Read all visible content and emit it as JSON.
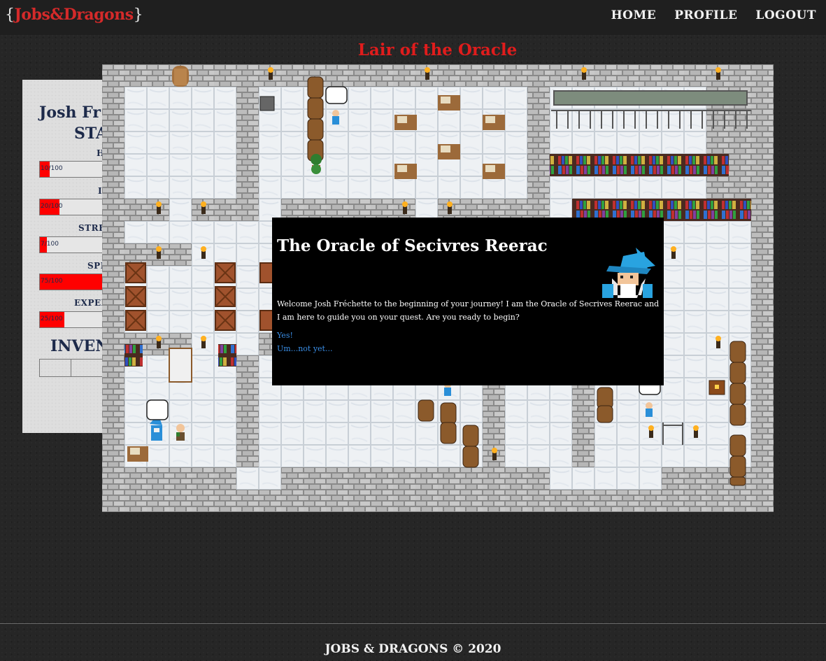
{
  "nav": {
    "brand_open": "{",
    "brand_name": "Jobs&Dragons",
    "brand_close": "}",
    "links": [
      "HOME",
      "PROFILE",
      "LOGOUT"
    ]
  },
  "page_title": "Lair of the Oracle",
  "stats": {
    "player_name": "Josh Fr",
    "heading": "STA",
    "items": [
      {
        "label": "H",
        "text": "10/100",
        "fraction": 0.1
      },
      {
        "label": "I",
        "text": "20/100",
        "fraction": 0.2
      },
      {
        "label": "STRE",
        "text": "7/100",
        "fraction": 0.07
      },
      {
        "label": "SPE",
        "text": "75/100",
        "fraction": 0.75
      },
      {
        "label": "EXPER",
        "text": "25/100",
        "fraction": 0.25
      }
    ],
    "inventory_heading": "INVEN"
  },
  "dialog": {
    "title": "The Oracle of Secivres Reerac",
    "message": "Welcome Josh Fréchette to the beginning of your journey! I am the Oracle of Secrives Reerac and I am here to guide you on your quest. Are you ready to begin?",
    "option_yes": "Yes!",
    "option_no": "Um...not yet..."
  },
  "footer": "JOBS & DRAGONS © 2020",
  "colors": {
    "brand_red": "#d42a2a",
    "title_red": "#e01c1c",
    "bar_fill": "#ff0000",
    "link_blue": "#3a8ee6",
    "navy_text": "#1d2a4a"
  }
}
